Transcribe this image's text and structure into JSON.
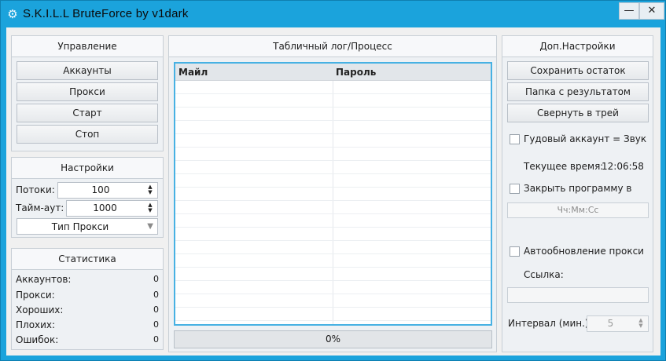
{
  "window": {
    "icon": "gear-icon",
    "title": "S.K.I.L.L BruteForce by v1dark",
    "minimize_label": "—",
    "close_label": "✕"
  },
  "management": {
    "header": "Управление",
    "accounts_button": "Аккаунты",
    "proxy_button": "Прокси",
    "start_button": "Старт",
    "stop_button": "Стоп"
  },
  "settings": {
    "header": "Настройки",
    "threads_label": "Потоки:",
    "threads_value": "100",
    "timeout_label": "Тайм-аут:",
    "timeout_value": "1000",
    "proxy_type_value": "Тип Прокси"
  },
  "statistics": {
    "header": "Статистика",
    "rows": [
      {
        "label": "Аккаунтов:",
        "value": "0"
      },
      {
        "label": "Прокси:",
        "value": "0"
      },
      {
        "label": "Хороших:",
        "value": "0"
      },
      {
        "label": "Плохих:",
        "value": "0"
      },
      {
        "label": "Ошибок:",
        "value": "0"
      }
    ]
  },
  "log": {
    "header": "Табличный лог/Процесс",
    "columns": [
      "Майл",
      "Пароль"
    ],
    "progress_text": "0%"
  },
  "extra": {
    "header": "Доп.Настройки",
    "save_rest_button": "Сохранить остаток",
    "results_folder_button": "Папка с результатом",
    "minimize_tray_button": "Свернуть в трей",
    "good_account_sound_label": "Гудовый аккаунт = Звук",
    "current_time_label": "Текущее время:",
    "current_time_value": "12:06:58",
    "close_program_label": "Закрыть программу в",
    "close_time_placeholder": "Чч:Мм:Сс",
    "auto_update_proxy_label": "Автообновление прокси",
    "link_label": "Ссылка:",
    "link_value": "",
    "interval_label": "Интервал (мин.)",
    "interval_value": "5"
  },
  "colors": {
    "titlebar": "#1ba3dc",
    "table_border": "#47b1e3"
  }
}
